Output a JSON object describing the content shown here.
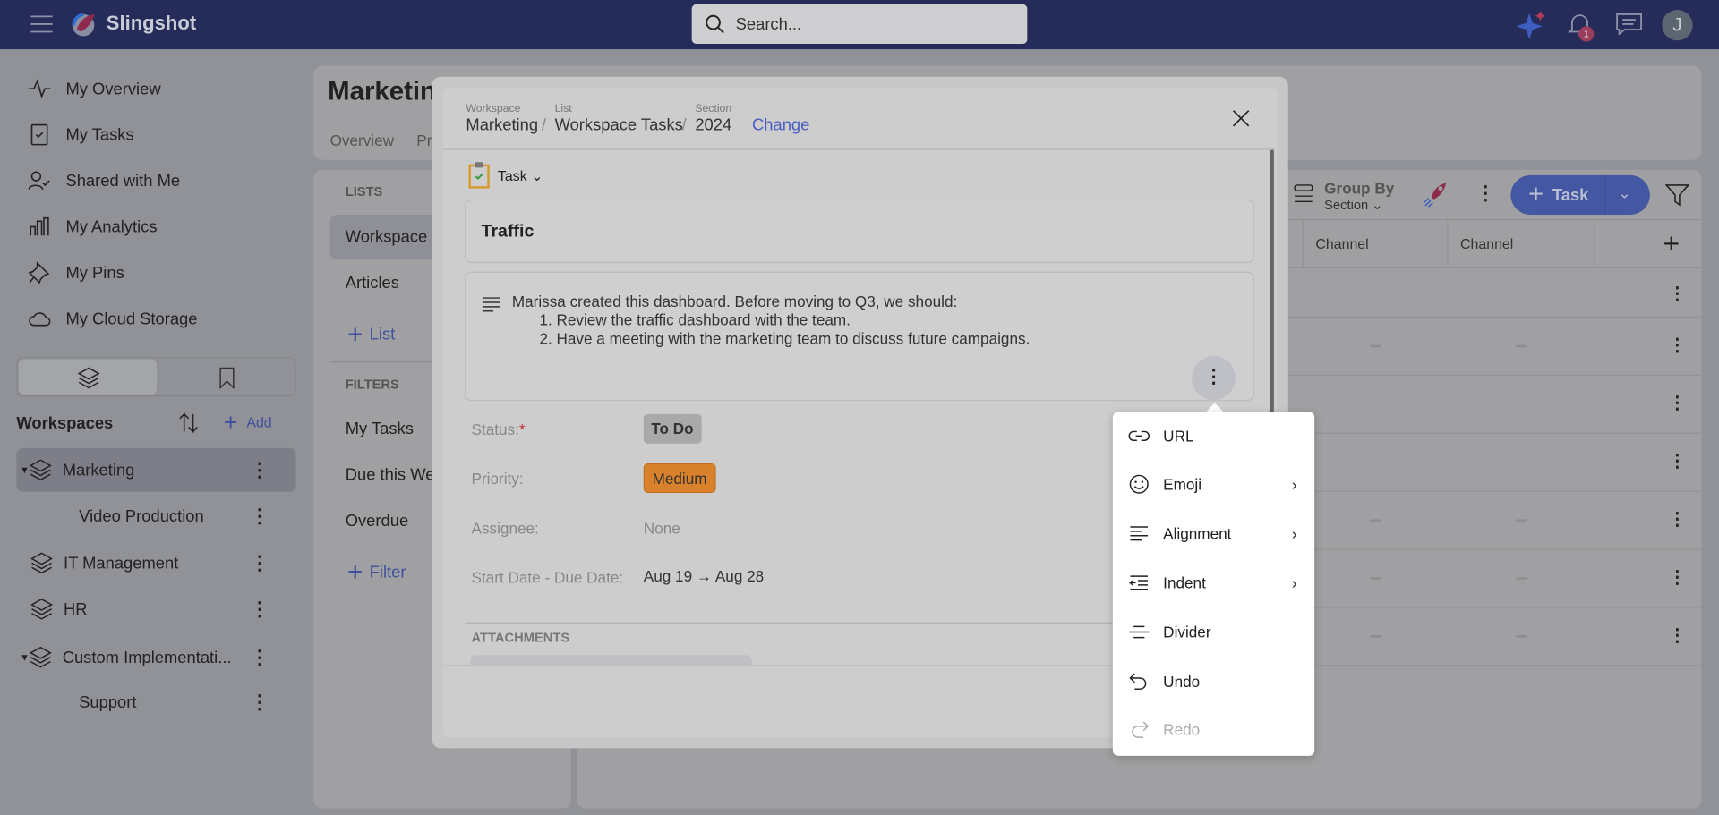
{
  "app": {
    "name": "Slingshot",
    "search_placeholder": "Search...",
    "notification_count": "1",
    "avatar_initial": "J"
  },
  "sidebar": {
    "items": [
      {
        "label": "My Overview",
        "icon": "activity-icon"
      },
      {
        "label": "My Tasks",
        "icon": "clipboard-icon"
      },
      {
        "label": "Shared with Me",
        "icon": "user-check-icon"
      },
      {
        "label": "My Analytics",
        "icon": "bar-chart-icon"
      },
      {
        "label": "My Pins",
        "icon": "pin-icon"
      },
      {
        "label": "My Cloud Storage",
        "icon": "cloud-icon"
      }
    ],
    "workspaces_title": "Workspaces",
    "add_label": "Add",
    "workspaces": [
      {
        "label": "Marketing",
        "expanded": true,
        "selected": true
      },
      {
        "label": "Video Production",
        "child": true
      },
      {
        "label": "IT Management"
      },
      {
        "label": "HR"
      },
      {
        "label": "Custom Implementati...",
        "expanded": true
      },
      {
        "label": "Support",
        "child": true
      }
    ]
  },
  "page": {
    "title": "Marketing",
    "tabs": [
      "Overview",
      "Pr"
    ]
  },
  "lists": {
    "title": "LISTS",
    "items": [
      "Workspace Tasks",
      "Articles"
    ],
    "add_list": "List",
    "filters_title": "FILTERS",
    "filters": [
      "My Tasks",
      "Due this Week",
      "Overdue"
    ],
    "add_filter": "Filter"
  },
  "toolbar": {
    "group_by": "Group By",
    "group_value": "Section",
    "task_button": "Task"
  },
  "table": {
    "columns": [
      "Channel",
      "Channel"
    ],
    "empty": "—"
  },
  "modal": {
    "crumbs": [
      {
        "label": "Workspace",
        "value": "Marketing"
      },
      {
        "label": "List",
        "value": "Workspace Tasks"
      },
      {
        "label": "Section",
        "value": "2024"
      }
    ],
    "change": "Change",
    "type": "Task",
    "title": "Traffic",
    "description": {
      "intro": "Marissa created this dashboard. Before moving to Q3, we should:",
      "items": [
        "1. Review the traffic dashboard with the team.",
        "2. Have a meeting with the marketing team to discuss future campaigns."
      ]
    },
    "fields": {
      "status_label": "Status:",
      "required": "*",
      "status": "To Do",
      "priority_label": "Priority:",
      "priority": "Medium",
      "assignee_label": "Assignee:",
      "assignee": "None",
      "dates_label": "Start Date - Due Date:",
      "start": "Aug 19",
      "due": "Aug 28"
    },
    "attachments": "ATTACHMENTS",
    "colors": {
      "priority": "#d9822b",
      "status": "#a9a9a9",
      "link": "#4a5fc1"
    }
  },
  "menu": {
    "items": [
      {
        "label": "URL",
        "icon": "link-icon"
      },
      {
        "label": "Emoji",
        "icon": "emoji-icon",
        "submenu": true
      },
      {
        "label": "Alignment",
        "icon": "align-left-icon",
        "submenu": true
      },
      {
        "label": "Indent",
        "icon": "indent-icon",
        "submenu": true
      },
      {
        "label": "Divider",
        "icon": "divider-icon"
      },
      {
        "label": "Undo",
        "icon": "undo-icon"
      },
      {
        "label": "Redo",
        "icon": "redo-icon",
        "disabled": true
      }
    ]
  }
}
